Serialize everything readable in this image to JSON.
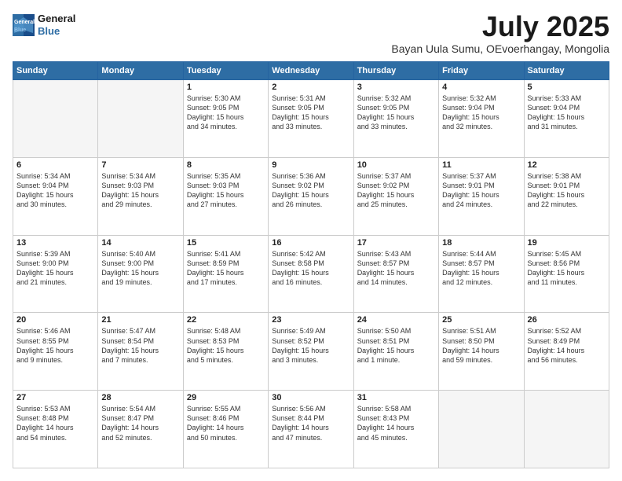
{
  "logo": {
    "line1": "General",
    "line2": "Blue"
  },
  "title": "July 2025",
  "subtitle": "Bayan Uula Sumu, OEvoerhangay, Mongolia",
  "days_header": [
    "Sunday",
    "Monday",
    "Tuesday",
    "Wednesday",
    "Thursday",
    "Friday",
    "Saturday"
  ],
  "weeks": [
    [
      {
        "day": "",
        "content": ""
      },
      {
        "day": "",
        "content": ""
      },
      {
        "day": "1",
        "content": "Sunrise: 5:30 AM\nSunset: 9:05 PM\nDaylight: 15 hours\nand 34 minutes."
      },
      {
        "day": "2",
        "content": "Sunrise: 5:31 AM\nSunset: 9:05 PM\nDaylight: 15 hours\nand 33 minutes."
      },
      {
        "day": "3",
        "content": "Sunrise: 5:32 AM\nSunset: 9:05 PM\nDaylight: 15 hours\nand 33 minutes."
      },
      {
        "day": "4",
        "content": "Sunrise: 5:32 AM\nSunset: 9:04 PM\nDaylight: 15 hours\nand 32 minutes."
      },
      {
        "day": "5",
        "content": "Sunrise: 5:33 AM\nSunset: 9:04 PM\nDaylight: 15 hours\nand 31 minutes."
      }
    ],
    [
      {
        "day": "6",
        "content": "Sunrise: 5:34 AM\nSunset: 9:04 PM\nDaylight: 15 hours\nand 30 minutes."
      },
      {
        "day": "7",
        "content": "Sunrise: 5:34 AM\nSunset: 9:03 PM\nDaylight: 15 hours\nand 29 minutes."
      },
      {
        "day": "8",
        "content": "Sunrise: 5:35 AM\nSunset: 9:03 PM\nDaylight: 15 hours\nand 27 minutes."
      },
      {
        "day": "9",
        "content": "Sunrise: 5:36 AM\nSunset: 9:02 PM\nDaylight: 15 hours\nand 26 minutes."
      },
      {
        "day": "10",
        "content": "Sunrise: 5:37 AM\nSunset: 9:02 PM\nDaylight: 15 hours\nand 25 minutes."
      },
      {
        "day": "11",
        "content": "Sunrise: 5:37 AM\nSunset: 9:01 PM\nDaylight: 15 hours\nand 24 minutes."
      },
      {
        "day": "12",
        "content": "Sunrise: 5:38 AM\nSunset: 9:01 PM\nDaylight: 15 hours\nand 22 minutes."
      }
    ],
    [
      {
        "day": "13",
        "content": "Sunrise: 5:39 AM\nSunset: 9:00 PM\nDaylight: 15 hours\nand 21 minutes."
      },
      {
        "day": "14",
        "content": "Sunrise: 5:40 AM\nSunset: 9:00 PM\nDaylight: 15 hours\nand 19 minutes."
      },
      {
        "day": "15",
        "content": "Sunrise: 5:41 AM\nSunset: 8:59 PM\nDaylight: 15 hours\nand 17 minutes."
      },
      {
        "day": "16",
        "content": "Sunrise: 5:42 AM\nSunset: 8:58 PM\nDaylight: 15 hours\nand 16 minutes."
      },
      {
        "day": "17",
        "content": "Sunrise: 5:43 AM\nSunset: 8:57 PM\nDaylight: 15 hours\nand 14 minutes."
      },
      {
        "day": "18",
        "content": "Sunrise: 5:44 AM\nSunset: 8:57 PM\nDaylight: 15 hours\nand 12 minutes."
      },
      {
        "day": "19",
        "content": "Sunrise: 5:45 AM\nSunset: 8:56 PM\nDaylight: 15 hours\nand 11 minutes."
      }
    ],
    [
      {
        "day": "20",
        "content": "Sunrise: 5:46 AM\nSunset: 8:55 PM\nDaylight: 15 hours\nand 9 minutes."
      },
      {
        "day": "21",
        "content": "Sunrise: 5:47 AM\nSunset: 8:54 PM\nDaylight: 15 hours\nand 7 minutes."
      },
      {
        "day": "22",
        "content": "Sunrise: 5:48 AM\nSunset: 8:53 PM\nDaylight: 15 hours\nand 5 minutes."
      },
      {
        "day": "23",
        "content": "Sunrise: 5:49 AM\nSunset: 8:52 PM\nDaylight: 15 hours\nand 3 minutes."
      },
      {
        "day": "24",
        "content": "Sunrise: 5:50 AM\nSunset: 8:51 PM\nDaylight: 15 hours\nand 1 minute."
      },
      {
        "day": "25",
        "content": "Sunrise: 5:51 AM\nSunset: 8:50 PM\nDaylight: 14 hours\nand 59 minutes."
      },
      {
        "day": "26",
        "content": "Sunrise: 5:52 AM\nSunset: 8:49 PM\nDaylight: 14 hours\nand 56 minutes."
      }
    ],
    [
      {
        "day": "27",
        "content": "Sunrise: 5:53 AM\nSunset: 8:48 PM\nDaylight: 14 hours\nand 54 minutes."
      },
      {
        "day": "28",
        "content": "Sunrise: 5:54 AM\nSunset: 8:47 PM\nDaylight: 14 hours\nand 52 minutes."
      },
      {
        "day": "29",
        "content": "Sunrise: 5:55 AM\nSunset: 8:46 PM\nDaylight: 14 hours\nand 50 minutes."
      },
      {
        "day": "30",
        "content": "Sunrise: 5:56 AM\nSunset: 8:44 PM\nDaylight: 14 hours\nand 47 minutes."
      },
      {
        "day": "31",
        "content": "Sunrise: 5:58 AM\nSunset: 8:43 PM\nDaylight: 14 hours\nand 45 minutes."
      },
      {
        "day": "",
        "content": ""
      },
      {
        "day": "",
        "content": ""
      }
    ]
  ]
}
